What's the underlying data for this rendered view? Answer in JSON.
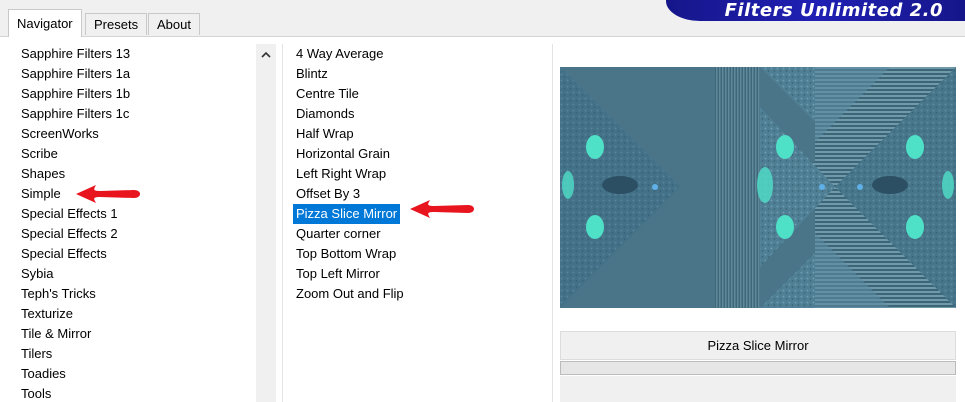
{
  "tabs": [
    {
      "label": "Navigator",
      "active": true
    },
    {
      "label": "Presets",
      "active": false
    },
    {
      "label": "About",
      "active": false
    }
  ],
  "banner": {
    "title": "Filters Unlimited 2.0"
  },
  "categories": {
    "selected": "Simple",
    "items": [
      "Sapphire Filters 13",
      "Sapphire Filters 1a",
      "Sapphire Filters 1b",
      "Sapphire Filters 1c",
      "ScreenWorks",
      "Scribe",
      "Shapes",
      "Simple",
      "Special Effects 1",
      "Special Effects 2",
      "Special Effects",
      "Sybia",
      "Teph's Tricks",
      "Texturize",
      "Tile & Mirror",
      "Tilers",
      "Toadies",
      "Tools"
    ]
  },
  "filters": {
    "selected": "Pizza Slice Mirror",
    "items": [
      "4 Way Average",
      "Blintz",
      "Centre Tile",
      "Diamonds",
      "Half Wrap",
      "Horizontal Grain",
      "Left Right Wrap",
      "Offset By 3",
      "Pizza Slice Mirror",
      "Quarter corner",
      "Top Bottom Wrap",
      "Top Left Mirror",
      "Zoom Out and Flip"
    ]
  },
  "preview": {
    "filter_name": "Pizza Slice Mirror",
    "progress": 0
  },
  "colors": {
    "selection": "#0078d7",
    "banner": "#1c1ca0",
    "annotation_arrow": "#e8141e",
    "preview_base": "#4a7488",
    "preview_accent": "#4fe0c8"
  },
  "icons": {
    "scroll_up": "chevron-up-icon",
    "annotation": "red-arrow-icon"
  }
}
